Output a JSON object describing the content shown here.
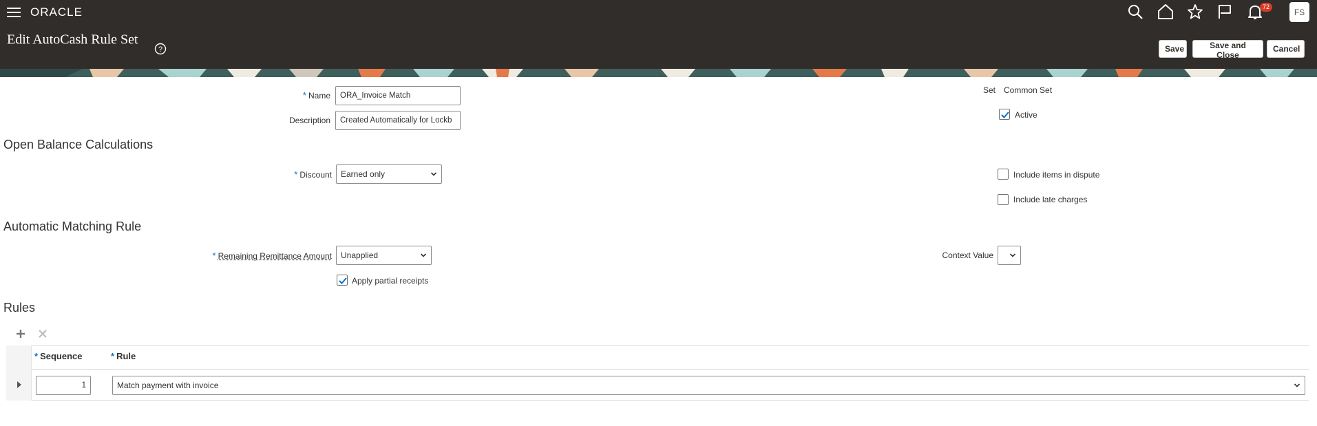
{
  "header": {
    "brand": "ORACLE",
    "page_title": "Edit AutoCash Rule Set",
    "notification_count": "72",
    "avatar_initials": "FS",
    "icons": [
      "hamburger-icon",
      "search-icon",
      "home-icon",
      "star-icon",
      "flag-icon",
      "bell-icon"
    ],
    "buttons": {
      "save": "Save",
      "save_and_close": "Save and Close",
      "cancel": "Cancel"
    }
  },
  "form": {
    "name_label": "Name",
    "name_value": "ORA_Invoice Match",
    "description_label": "Description",
    "description_value": "Created Automatically for Lockb",
    "set_label": "Set",
    "set_value": "Common Set",
    "active_label": "Active",
    "active_checked": true
  },
  "open_balance": {
    "title": "Open Balance Calculations",
    "discount_label": "Discount",
    "discount_value": "Earned only",
    "include_dispute_label": "Include items in dispute",
    "include_dispute_checked": false,
    "include_late_label": "Include late charges",
    "include_late_checked": false
  },
  "matching": {
    "title": "Automatic Matching Rule",
    "remaining_label": "Remaining Remittance Amount",
    "remaining_value": "Unapplied",
    "context_label": "Context Value",
    "context_value": "",
    "apply_partial_label": "Apply partial receipts",
    "apply_partial_checked": true
  },
  "rules": {
    "title": "Rules",
    "columns": [
      "Sequence",
      "Rule"
    ],
    "rows": [
      {
        "sequence": "1",
        "rule": "Match payment with invoice"
      }
    ]
  },
  "colors": {
    "header_bg": "#312d2a",
    "required": "#0572ce",
    "badge": "#d63b25"
  }
}
